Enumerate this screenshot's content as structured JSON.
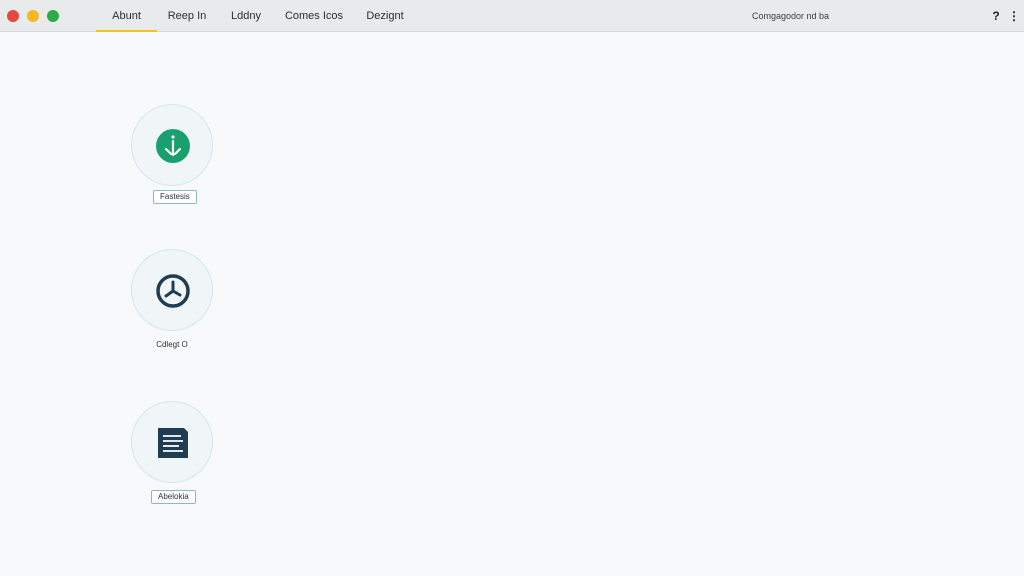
{
  "window": {
    "controls": [
      "close-button",
      "minimize-button",
      "maximize-button"
    ]
  },
  "tabs": [
    {
      "label": "Abunt",
      "active": true
    },
    {
      "label": "Reep In",
      "active": false
    },
    {
      "label": "Lddny",
      "active": false
    },
    {
      "label": "Comes Icos",
      "active": false
    },
    {
      "label": "Dezignt",
      "active": false
    }
  ],
  "header": {
    "search_text": "Comgagodor nd ba",
    "help_glyph": "?",
    "more_glyph": "⋮"
  },
  "nodes": [
    {
      "label": "Fastesis",
      "icon": "download-arrow-icon",
      "icon_color": "#1aa06e"
    },
    {
      "label": "Cdlegt O",
      "icon": "clock-icon",
      "icon_color": "#1e3d52"
    },
    {
      "label": "Abelokia",
      "icon": "document-icon",
      "icon_color": "#1e3d52"
    }
  ],
  "colors": {
    "accent": "#f0c419",
    "green": "#1aa06e",
    "navy": "#1e3d52",
    "background": "#f7f9fa"
  }
}
